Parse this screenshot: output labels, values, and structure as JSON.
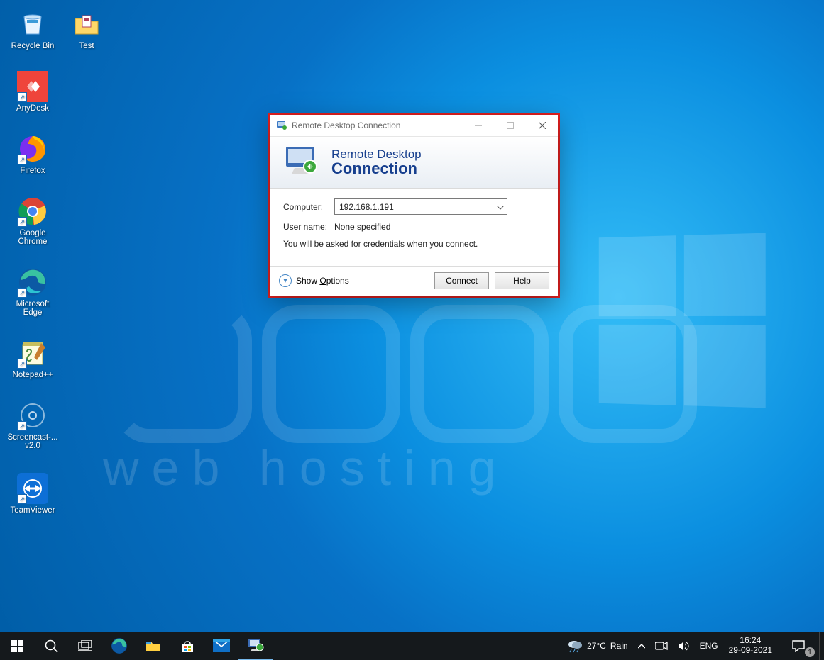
{
  "desktop_icons": [
    {
      "label": "Recycle Bin",
      "name": "recycle-bin",
      "shortcut": false
    },
    {
      "label": "Test",
      "name": "folder-test",
      "shortcut": false
    },
    {
      "label": "AnyDesk",
      "name": "anydesk",
      "shortcut": true
    },
    {
      "label": "Firefox",
      "name": "firefox",
      "shortcut": true
    },
    {
      "label": "Google Chrome",
      "name": "google-chrome",
      "shortcut": true
    },
    {
      "label": "Microsoft Edge",
      "name": "microsoft-edge",
      "shortcut": true
    },
    {
      "label": "Notepad++",
      "name": "notepad-plus-plus",
      "shortcut": true
    },
    {
      "label": "Screencast-... v2.0",
      "name": "screencast",
      "shortcut": true
    },
    {
      "label": "TeamViewer",
      "name": "teamviewer",
      "shortcut": true
    }
  ],
  "rdp": {
    "title": "Remote Desktop Connection",
    "banner_line1": "Remote Desktop",
    "banner_line2": "Connection",
    "computer_label": "Computer:",
    "computer_value": "192.168.1.191",
    "username_label": "User name:",
    "username_value": "None specified",
    "note": "You will be asked for credentials when you connect.",
    "show_options_prefix": "Show ",
    "show_options_u": "O",
    "show_options_rest": "ptions",
    "connect": "Connect",
    "help": "Help"
  },
  "taskbar": {
    "weather_temp": "27°C",
    "weather_cond": "Rain",
    "lang": "ENG",
    "time": "16:24",
    "date": "29-09-2021",
    "notif_count": "1"
  },
  "watermark": "web  hosting"
}
